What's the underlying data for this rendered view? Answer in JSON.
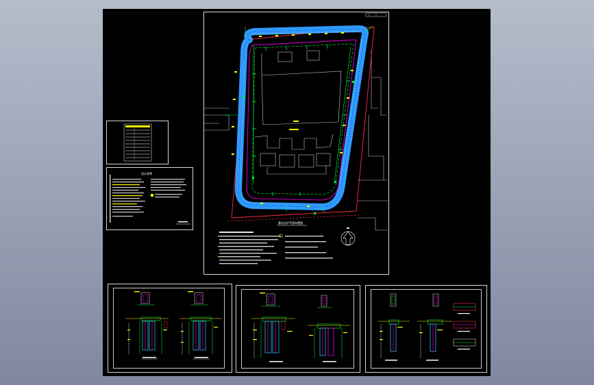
{
  "colors": {
    "background": "#000000",
    "wall_outline": "#1e6cff",
    "wall_fill": "#2f9bff",
    "site_boundary": "#ff3040",
    "dimension": "#00ff3c",
    "annotation": "#ffff00",
    "building": "#c8c8c8",
    "rebar": "#ff00ff",
    "pile": "#3ad1ff"
  },
  "sheets": {
    "plan": {
      "name": "support-plan-sheet",
      "caption": "基坑支护平面布置图"
    },
    "legend": {
      "name": "legend-table-sheet"
    },
    "notes": {
      "name": "design-notes-sheet",
      "title": "设计说明"
    },
    "section_a": {
      "name": "section-detail-sheet-1"
    },
    "section_b": {
      "name": "section-detail-sheet-2"
    },
    "section_c": {
      "name": "section-detail-sheet-3"
    }
  },
  "icons": {
    "north_arrow": "north-arrow-icon"
  }
}
